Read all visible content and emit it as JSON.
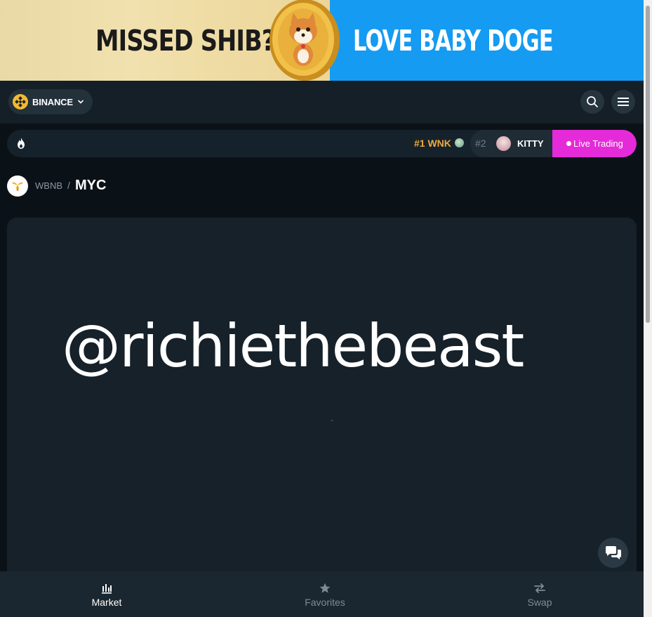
{
  "banner": {
    "left_text": "MISSED SHIB?",
    "right_text": "LOVE BABY DOGE"
  },
  "header": {
    "chain_label": "BINANCE"
  },
  "ticker": {
    "item1": {
      "rank": "#1",
      "symbol": "WNK"
    },
    "item2": {
      "rank": "#2",
      "symbol": "KITTY"
    },
    "live_label": "Live Trading"
  },
  "pair": {
    "base": "WBNB",
    "separator": "/",
    "quote": "MYC"
  },
  "chart_area": {
    "watermark": "@richiethebeast"
  },
  "bottom_nav": {
    "items": [
      {
        "label": "Market",
        "icon": "bar-chart-icon",
        "active": true
      },
      {
        "label": "Favorites",
        "icon": "star-icon",
        "active": false
      },
      {
        "label": "Swap",
        "icon": "swap-arrows-icon",
        "active": false
      }
    ]
  },
  "colors": {
    "accent_live": "#e52ad9",
    "rank1": "#f0a93a",
    "background": "#0b1217",
    "panel": "#16212a"
  }
}
